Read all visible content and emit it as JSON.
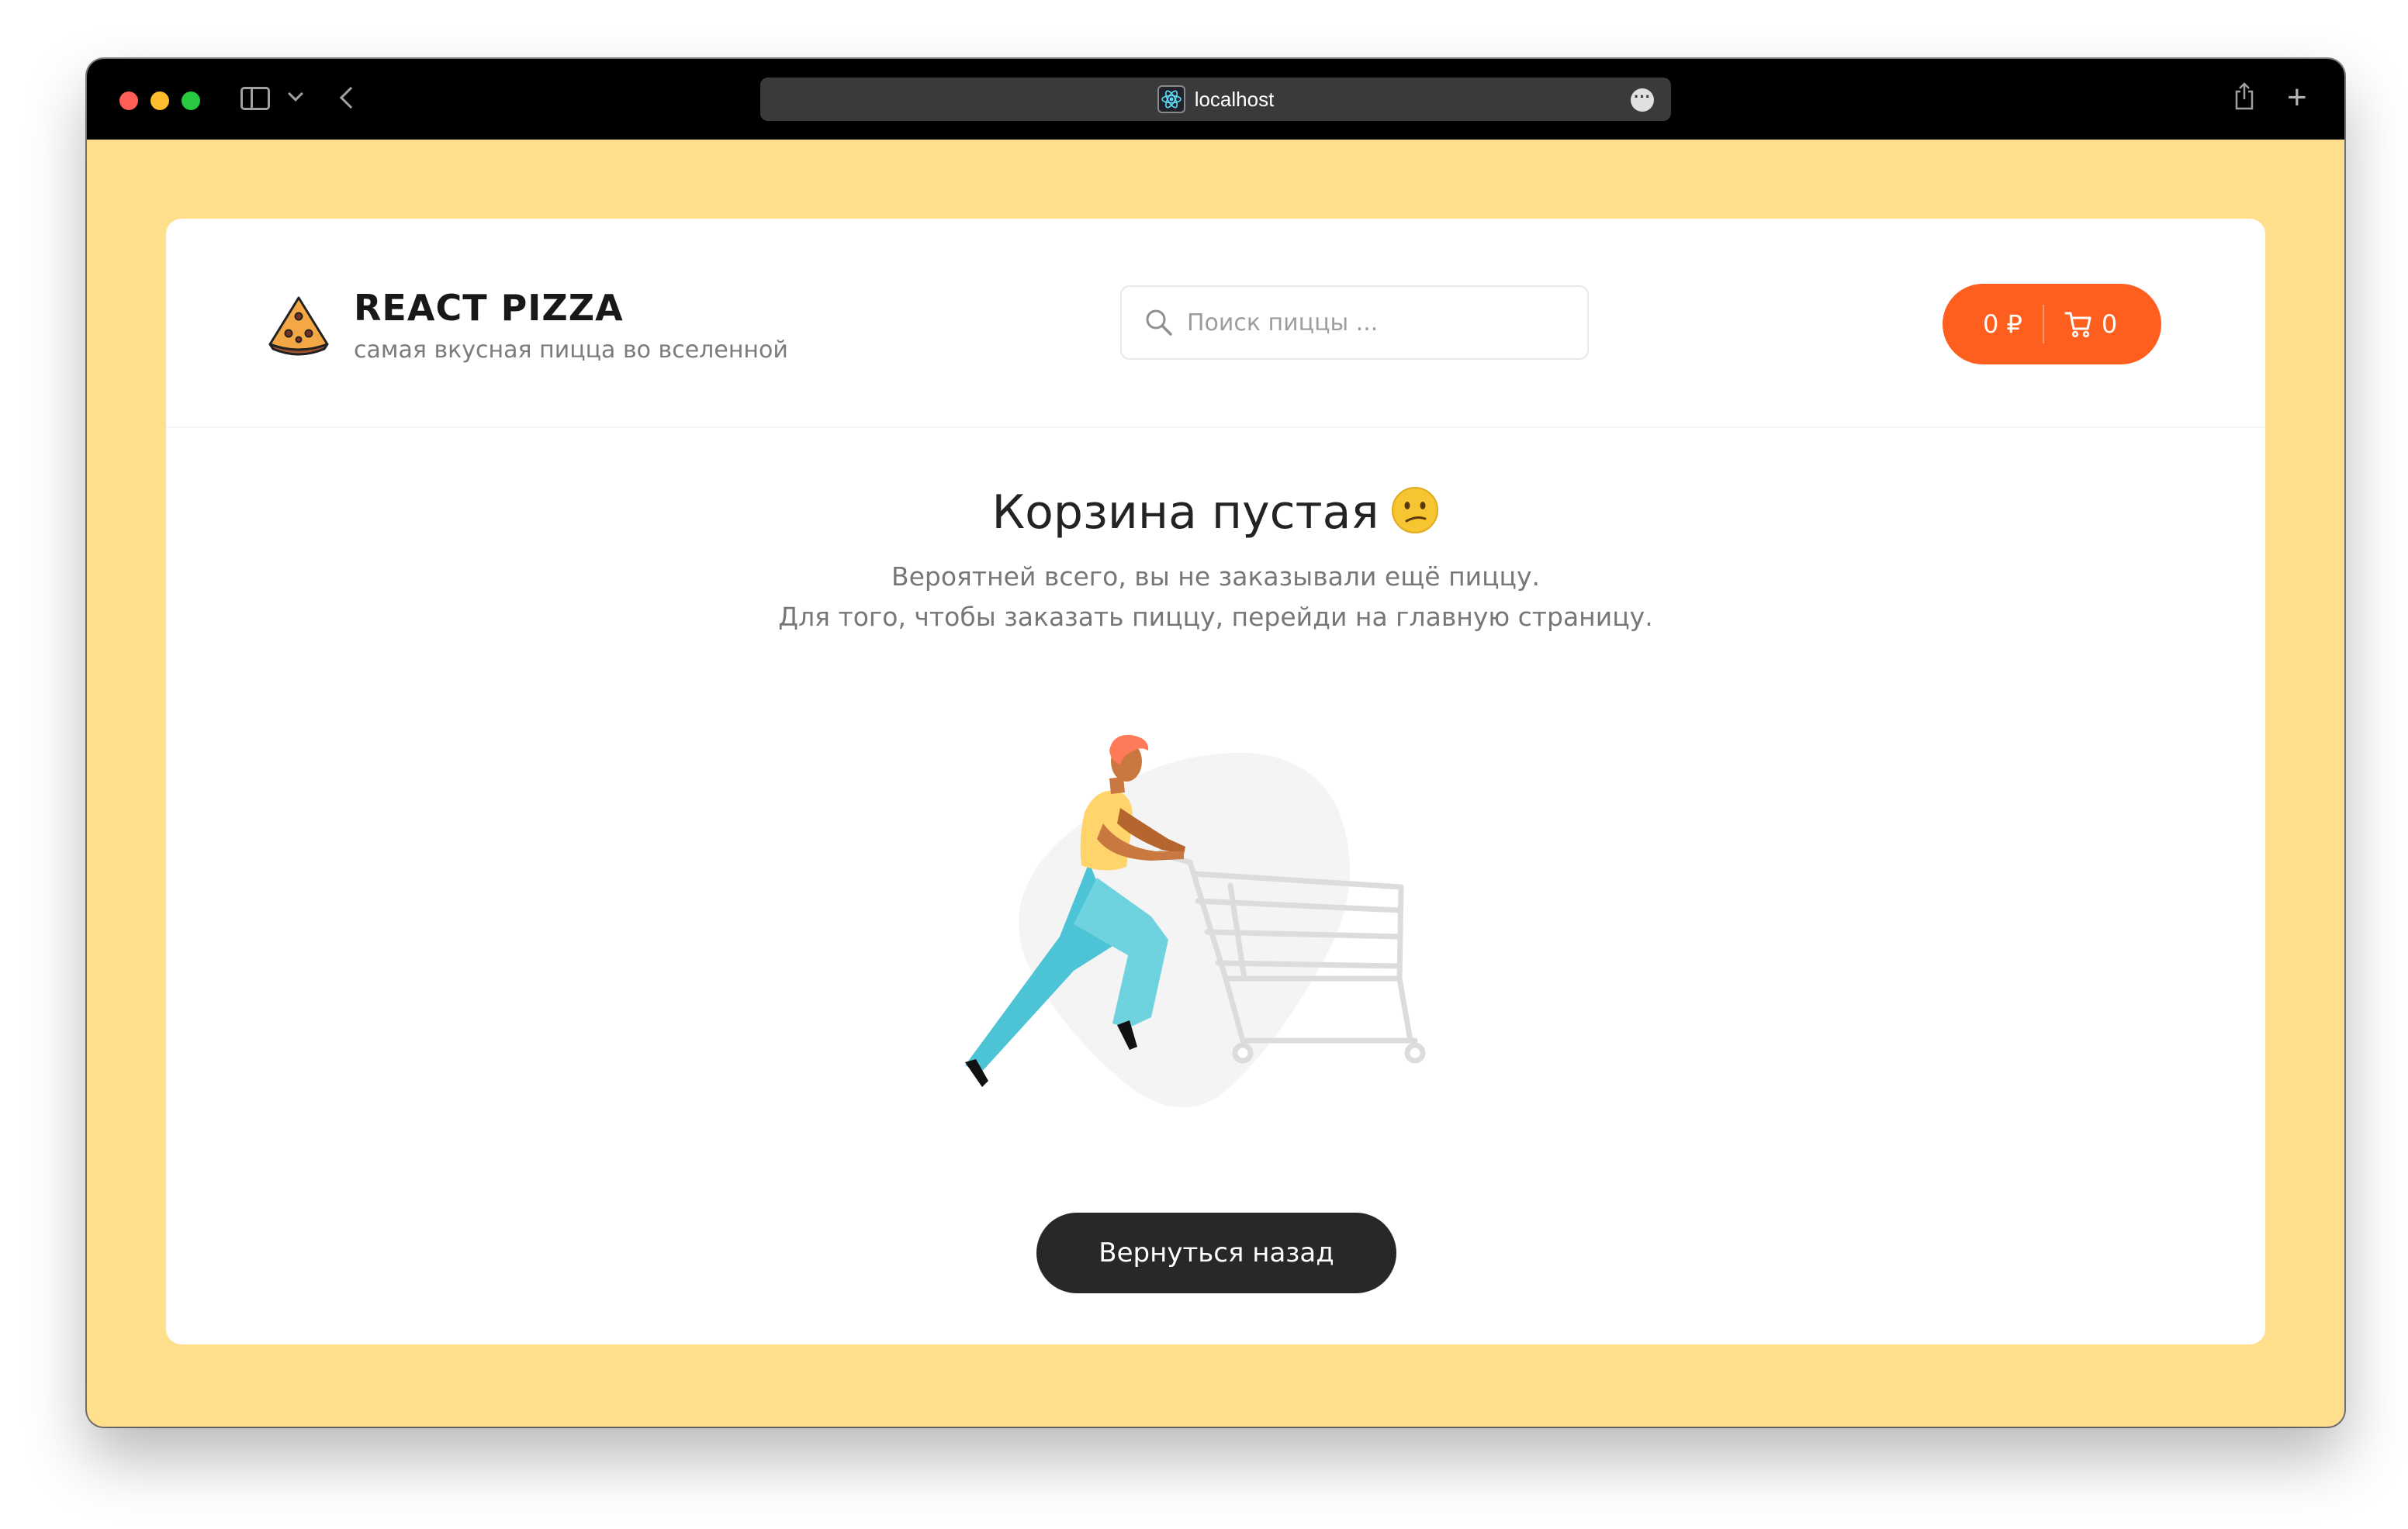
{
  "browser": {
    "url": "localhost"
  },
  "header": {
    "brand_title": "REACT PIZZA",
    "brand_subtitle": "самая вкусная пицца во вселенной",
    "search_placeholder": "Поиск пиццы ...",
    "cart_price": "0 ₽",
    "cart_count": "0"
  },
  "empty_cart": {
    "title": "Корзина пустая",
    "line1": "Вероятней всего, вы не заказывали ещё пиццу.",
    "line2": "Для того, чтобы заказать пиццу, перейди на главную страницу.",
    "back_button": "Вернуться назад"
  },
  "colors": {
    "page_background": "#ffdf8c",
    "accent": "#fe5f1e",
    "button_dark": "#282828"
  }
}
